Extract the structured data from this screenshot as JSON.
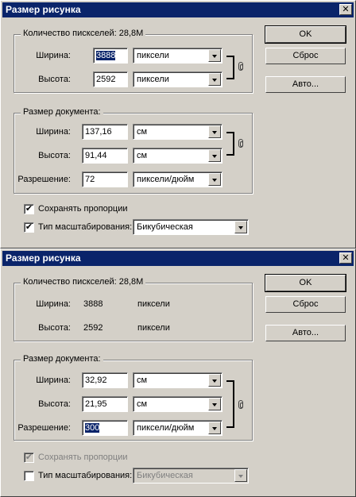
{
  "dialog1": {
    "title": "Размер рисунка",
    "close": "✕",
    "pixel_group": "Количество пискселей: 28,8M",
    "width_label": "Ширина:",
    "height_label": "Высота:",
    "width_value": "3888",
    "height_value": "2592",
    "width_unit": "пиксели",
    "height_unit": "пиксели",
    "doc_group": "Размер документа:",
    "doc_width_label": "Ширина:",
    "doc_height_label": "Высота:",
    "resolution_label": "Разрешение:",
    "doc_width_value": "137,16",
    "doc_height_value": "91,44",
    "resolution_value": "72",
    "doc_width_unit": "см",
    "doc_height_unit": "см",
    "resolution_unit": "пиксели/дюйм",
    "keep_proportions": "Сохранять пропорции",
    "resample_label": "Тип масштабирования:",
    "resample_value": "Бикубическая",
    "ok": "OK",
    "reset": "Сброс",
    "auto": "Авто..."
  },
  "dialog2": {
    "title": "Размер рисунка",
    "close": "✕",
    "pixel_group": "Количество пискселей: 28,8M",
    "width_label": "Ширина:",
    "height_label": "Высота:",
    "width_value": "3888",
    "height_value": "2592",
    "width_unit": "пиксели",
    "height_unit": "пиксели",
    "doc_group": "Размер документа:",
    "doc_width_label": "Ширина:",
    "doc_height_label": "Высота:",
    "resolution_label": "Разрешение:",
    "doc_width_value": "32,92",
    "doc_height_value": "21,95",
    "resolution_value": "300",
    "doc_width_unit": "см",
    "doc_height_unit": "см",
    "resolution_unit": "пиксели/дюйм",
    "keep_proportions": "Сохранять пропорции",
    "resample_label": "Тип масштабирования:",
    "resample_value": "Бикубическая",
    "ok": "OK",
    "reset": "Сброс",
    "auto": "Авто..."
  },
  "checks": {
    "on": "✔",
    "off": ""
  }
}
